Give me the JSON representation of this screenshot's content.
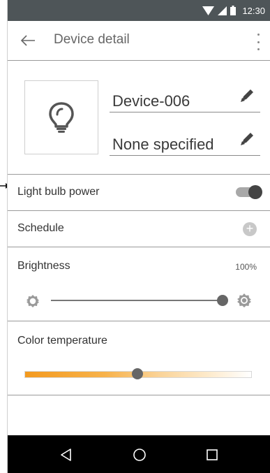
{
  "status_bar": {
    "time": "12:30"
  },
  "app_bar": {
    "title": "Device detail"
  },
  "device": {
    "name": "Device-006",
    "location": "None specified"
  },
  "power": {
    "label": "Light bulb power",
    "on": true
  },
  "schedule": {
    "label": "Schedule"
  },
  "brightness": {
    "label": "Brightness",
    "value_text": "100%",
    "value": 1.0
  },
  "color_temperature": {
    "label": "Color temperature",
    "value": 0.5
  },
  "icons": {
    "back": "arrow-left-icon",
    "overflow": "more-vert-icon",
    "device": "lightbulb-icon",
    "edit": "pencil-icon",
    "add": "plus-circle-icon",
    "brightness_low": "brightness-low-icon",
    "brightness_high": "brightness-high-icon",
    "nav_back": "triangle-back-icon",
    "nav_home": "circle-home-icon",
    "nav_recents": "square-recents-icon"
  },
  "colors": {
    "status_bar": "#4e5558",
    "temperature_start": "#f39a1e",
    "temperature_end": "#ffffff",
    "toggle_knob": "#444444"
  }
}
